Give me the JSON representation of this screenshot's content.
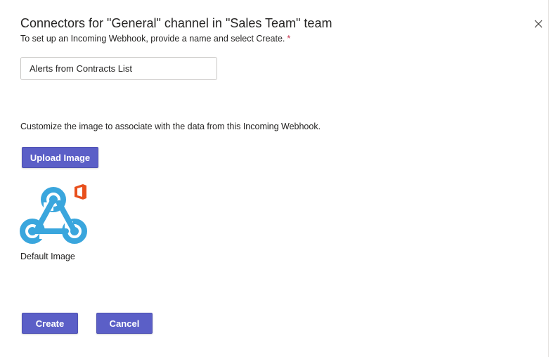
{
  "dialog": {
    "title": "Connectors for \"General\" channel in \"Sales Team\" team",
    "subtitle": "To set up an Incoming Webhook, provide a name and select Create.",
    "required_marker": "*",
    "close_icon": "close-icon"
  },
  "name_field": {
    "value": "Alerts from Contracts List"
  },
  "image_section": {
    "instruction": "Customize the image to associate with the data from this Incoming Webhook.",
    "upload_label": "Upload Image",
    "default_image_label": "Default Image",
    "default_image_icon": "webhook-icon"
  },
  "actions": {
    "create_label": "Create",
    "cancel_label": "Cancel"
  },
  "colors": {
    "accent": "#5b5fc7",
    "webhook_blue": "#3aa6dd",
    "office_orange": "#e84f1c",
    "required_red": "#c4314b"
  }
}
